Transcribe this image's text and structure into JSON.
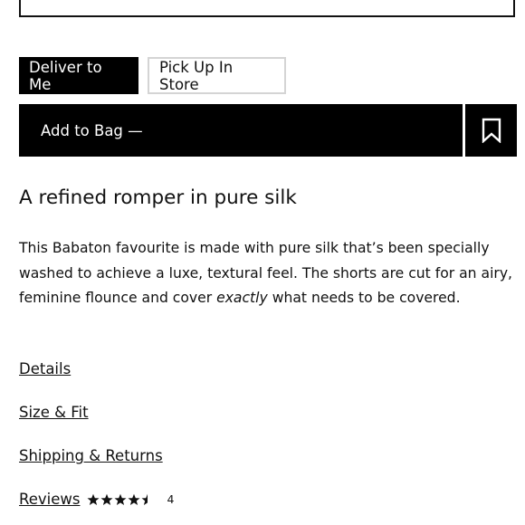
{
  "delivery": {
    "deliver_label": "Deliver to Me",
    "pickup_label": "Pick Up In Store",
    "selected": "Deliver to Me"
  },
  "bag": {
    "add_label": "Add to Bag —",
    "wishlist_icon": "bookmark-icon"
  },
  "product": {
    "headline": "A refined romper in pure silk",
    "description_before": "This Babaton favourite is made with pure silk that’s been specially washed to achieve a luxe, textural feel. The shorts are cut for an airy, feminine flounce and cover ",
    "description_emphasis": "exactly",
    "description_after": " what needs to be covered."
  },
  "accordion": {
    "details": "Details",
    "size_fit": "Size & Fit",
    "shipping_returns": "Shipping & Returns",
    "reviews": "Reviews"
  },
  "reviews": {
    "rating": 4.5,
    "max": 5,
    "count": "4"
  },
  "colors": {
    "primary": "#000000",
    "text": "#111111",
    "inactive_border": "#d4d4d4"
  }
}
